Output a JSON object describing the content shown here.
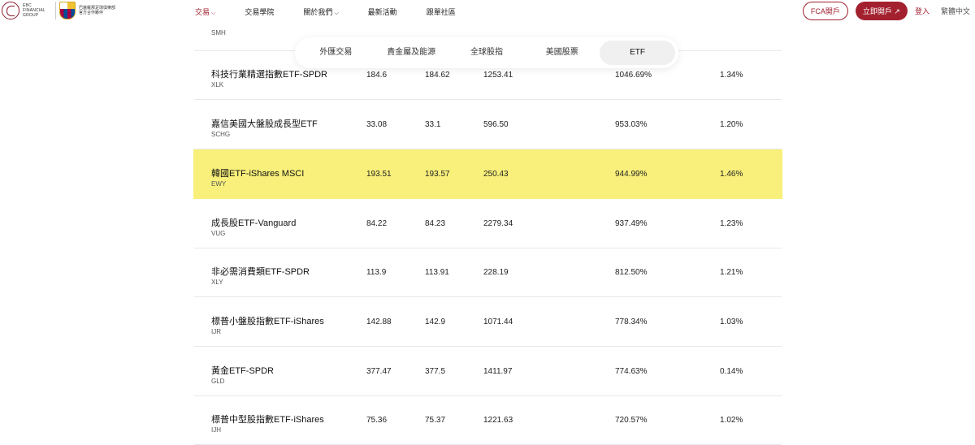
{
  "header": {
    "logo_text": "EBC FINANCIAL GROUP",
    "crest_text": "巴塞羅那足球俱樂部官方合作夥伴",
    "nav": [
      {
        "label": "交易",
        "dropdown": true,
        "active": true
      },
      {
        "label": "交易學院",
        "dropdown": false
      },
      {
        "label": "關於我們",
        "dropdown": true
      },
      {
        "label": "最新活動",
        "dropdown": false
      },
      {
        "label": "跟單社區",
        "dropdown": false
      }
    ],
    "fca_button": "FCA開戶",
    "open_account_button": "立即開戶 ↗",
    "login": "登入",
    "language": "繁體中文"
  },
  "tabs": {
    "items": [
      "外匯交易",
      "貴金屬及能源",
      "全球股指",
      "美國股票",
      "ETF"
    ],
    "active": "ETF"
  },
  "table": {
    "partial_row_code": "SMH",
    "rows": [
      {
        "name": "科技行業精選指數ETF-SPDR",
        "code": "XLK",
        "c1": "184.6",
        "c2": "184.62",
        "c3": "1253.41",
        "c4": "1046.69%",
        "c5": "1.34%"
      },
      {
        "name": "嘉信美國大盤股成長型ETF",
        "code": "SCHG",
        "c1": "33.08",
        "c2": "33.1",
        "c3": "596.50",
        "c4": "953.03%",
        "c5": "1.20%"
      },
      {
        "name": "韓國ETF-iShares MSCI",
        "code": "EWY",
        "c1": "193.51",
        "c2": "193.57",
        "c3": "250.43",
        "c4": "944.99%",
        "c5": "1.46%",
        "highlight": true
      },
      {
        "name": "成長股ETF-Vanguard",
        "code": "VUG",
        "c1": "84.22",
        "c2": "84.23",
        "c3": "2279.34",
        "c4": "937.49%",
        "c5": "1.23%"
      },
      {
        "name": "非必需消費類ETF-SPDR",
        "code": "XLY",
        "c1": "113.9",
        "c2": "113.91",
        "c3": "228.19",
        "c4": "812.50%",
        "c5": "1.21%"
      },
      {
        "name": "標普小盤股指數ETF-iShares",
        "code": "IJR",
        "c1": "142.88",
        "c2": "142.9",
        "c3": "1071.44",
        "c4": "778.34%",
        "c5": "1.03%"
      },
      {
        "name": "黃金ETF-SPDR",
        "code": "GLD",
        "c1": "377.47",
        "c2": "377.5",
        "c3": "1411.97",
        "c4": "774.63%",
        "c5": "0.14%"
      },
      {
        "name": "標普中型股指數ETF-iShares",
        "code": "IJH",
        "c1": "75.36",
        "c2": "75.37",
        "c3": "1221.63",
        "c4": "720.57%",
        "c5": "1.02%"
      }
    ]
  }
}
